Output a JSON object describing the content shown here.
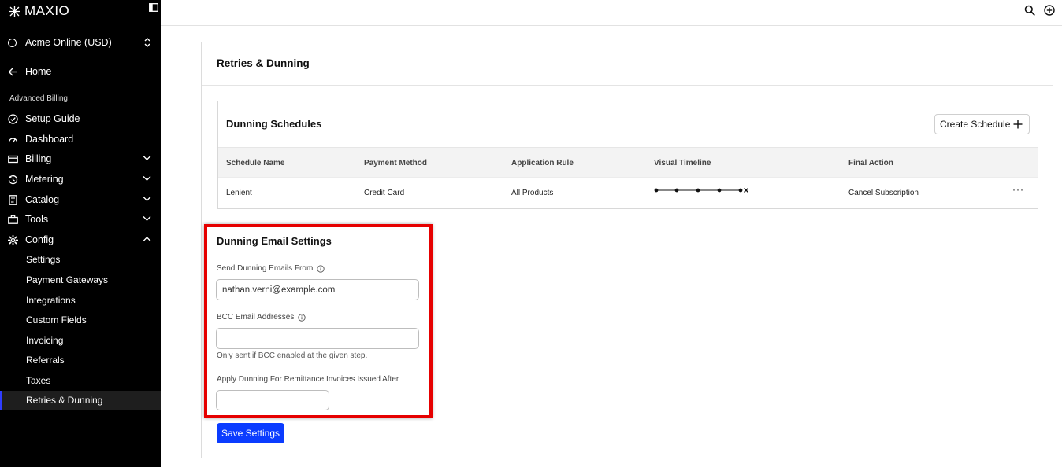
{
  "brand": {
    "name": "MAXIO"
  },
  "account": {
    "name": "Acme Online (USD)"
  },
  "nav": {
    "home": "Home",
    "section": "Advanced Billing",
    "items": [
      "Setup Guide",
      "Dashboard",
      "Billing",
      "Metering",
      "Catalog",
      "Tools",
      "Config"
    ],
    "config_sub": [
      "Settings",
      "Payment Gateways",
      "Integrations",
      "Custom Fields",
      "Invoicing",
      "Referrals",
      "Taxes",
      "Retries & Dunning"
    ]
  },
  "page": {
    "title": "Retries & Dunning"
  },
  "schedules": {
    "title": "Dunning Schedules",
    "create_label": "Create Schedule",
    "columns": [
      "Schedule Name",
      "Payment Method",
      "Application Rule",
      "Visual Timeline",
      "Final Action"
    ],
    "rows": [
      {
        "name": "Lenient",
        "payment_method": "Credit Card",
        "rule": "All Products",
        "final_action": "Cancel Subscription",
        "more": "···"
      }
    ]
  },
  "email_settings": {
    "title": "Dunning Email Settings",
    "from_label": "Send Dunning Emails From",
    "from_value": "nathan.verni@example.com",
    "bcc_label": "BCC Email Addresses",
    "bcc_value": "",
    "bcc_hint": "Only sent if BCC enabled at the given step.",
    "remittance_label": "Apply Dunning For Remittance Invoices Issued After",
    "remittance_value": ""
  },
  "save_label": "Save Settings",
  "colors": {
    "sidebar_bg": "#000000",
    "primary": "#0b3cff",
    "highlight": "#e60000"
  }
}
